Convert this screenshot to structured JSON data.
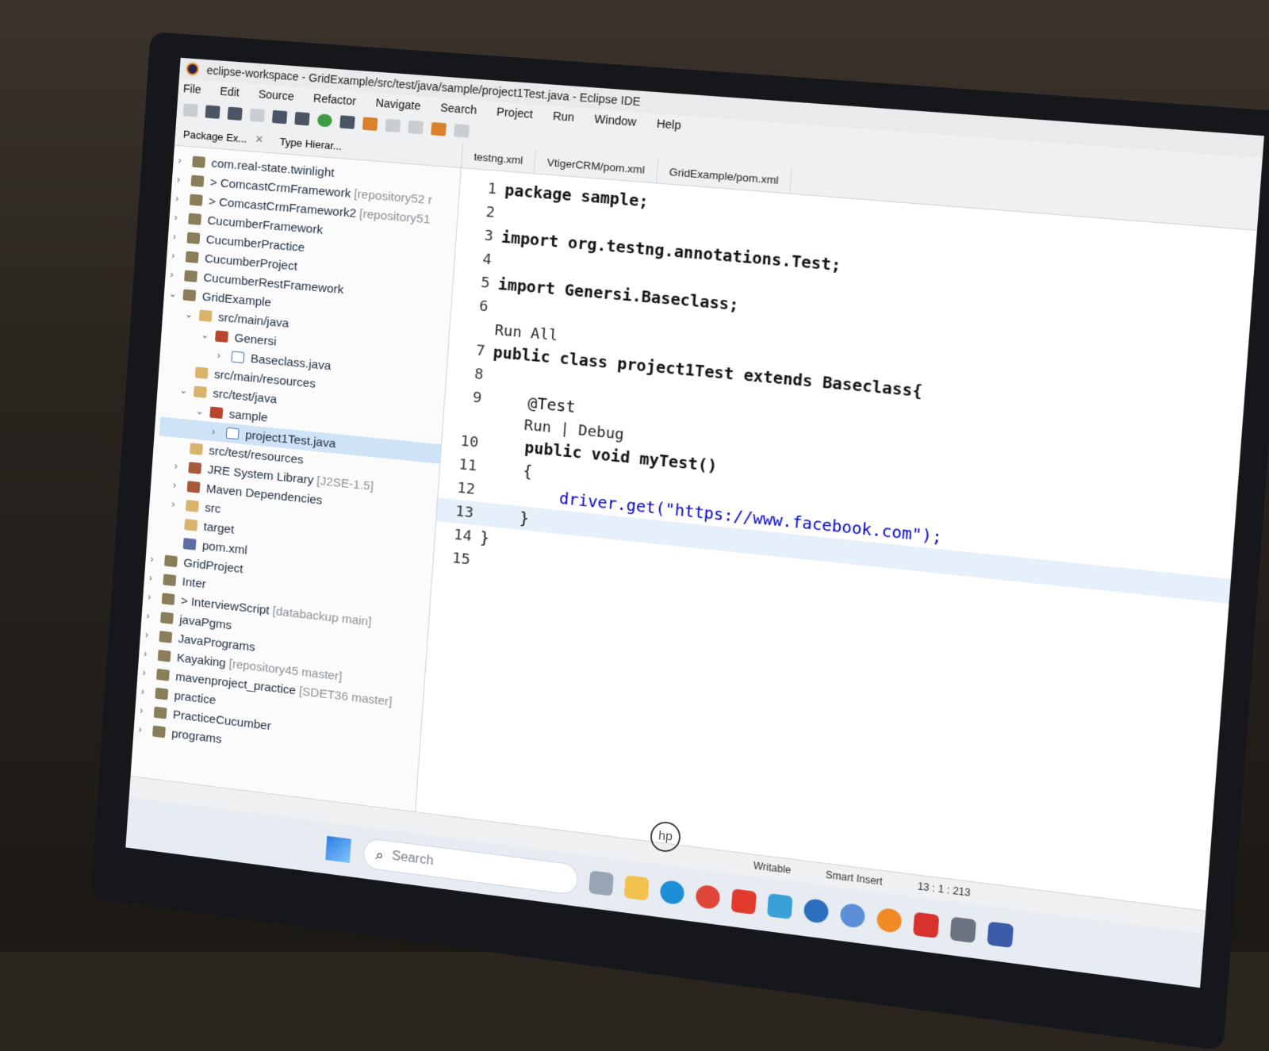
{
  "window": {
    "title": "eclipse-workspace - GridExample/src/test/java/sample/project1Test.java - Eclipse IDE"
  },
  "menu": [
    "File",
    "Edit",
    "Source",
    "Refactor",
    "Navigate",
    "Search",
    "Project",
    "Run",
    "Window",
    "Help"
  ],
  "explorer": {
    "tabs": [
      "Package Ex...",
      "Type Hierar..."
    ],
    "items": [
      {
        "label": "com.real-state.twinlight",
        "extra": ""
      },
      {
        "label": "> ComcastCrmFramework",
        "extra": "[repository52 r"
      },
      {
        "label": "> ComcastCrmFramework2",
        "extra": "[repository51"
      },
      {
        "label": "CucumberFramework",
        "extra": ""
      },
      {
        "label": "CucumberPractice",
        "extra": ""
      },
      {
        "label": "CucumberProject",
        "extra": ""
      },
      {
        "label": "CucumberRestFramework",
        "extra": ""
      },
      {
        "label": "GridExample",
        "extra": ""
      },
      {
        "label": "src/main/java",
        "extra": ""
      },
      {
        "label": "Genersi",
        "extra": ""
      },
      {
        "label": "Baseclass.java",
        "extra": ""
      },
      {
        "label": "src/main/resources",
        "extra": ""
      },
      {
        "label": "src/test/java",
        "extra": ""
      },
      {
        "label": "sample",
        "extra": ""
      },
      {
        "label": "project1Test.java",
        "extra": ""
      },
      {
        "label": "src/test/resources",
        "extra": ""
      },
      {
        "label": "JRE System Library",
        "extra": "[J2SE-1.5]"
      },
      {
        "label": "Maven Dependencies",
        "extra": ""
      },
      {
        "label": "src",
        "extra": ""
      },
      {
        "label": "target",
        "extra": ""
      },
      {
        "label": "pom.xml",
        "extra": ""
      },
      {
        "label": "GridProject",
        "extra": ""
      },
      {
        "label": "Inter",
        "extra": ""
      },
      {
        "label": "> InterviewScript",
        "extra": "[databackup main]"
      },
      {
        "label": "javaPgms",
        "extra": ""
      },
      {
        "label": "JavaPrograms",
        "extra": ""
      },
      {
        "label": "Kayaking",
        "extra": "[repository45 master]"
      },
      {
        "label": "mavenproject_practice",
        "extra": "[SDET36 master]"
      },
      {
        "label": "practice",
        "extra": ""
      },
      {
        "label": "PracticeCucumber",
        "extra": ""
      },
      {
        "label": "programs",
        "extra": ""
      }
    ]
  },
  "editor": {
    "tabs": [
      "testng.xml",
      "VtigerCRM/pom.xml",
      "GridExample/pom.xml"
    ],
    "lines": [
      {
        "n": "1",
        "text": "package sample;"
      },
      {
        "n": "2",
        "text": ""
      },
      {
        "n": "3",
        "text": "import org.testng.annotations.Test;"
      },
      {
        "n": "4",
        "text": ""
      },
      {
        "n": "5",
        "text": "import Genersi.Baseclass;"
      },
      {
        "n": "6",
        "text": ""
      },
      {
        "n": "",
        "text": "Run All"
      },
      {
        "n": "7",
        "text": "public class project1Test extends Baseclass{"
      },
      {
        "n": "8",
        "text": ""
      },
      {
        "n": "9",
        "text": "    @Test"
      },
      {
        "n": "",
        "text": "    Run | Debug"
      },
      {
        "n": "10",
        "text": "    public void myTest()"
      },
      {
        "n": "11",
        "text": "    {"
      },
      {
        "n": "12",
        "text": "        driver.get(\"https://www.facebook.com\");"
      },
      {
        "n": "13",
        "text": "    }"
      },
      {
        "n": "14",
        "text": "}"
      },
      {
        "n": "15",
        "text": ""
      }
    ]
  },
  "status": {
    "mode": "Writable",
    "insert": "Smart Insert",
    "position": "13 : 1 : 213"
  },
  "taskbar": {
    "search_placeholder": "Search"
  }
}
